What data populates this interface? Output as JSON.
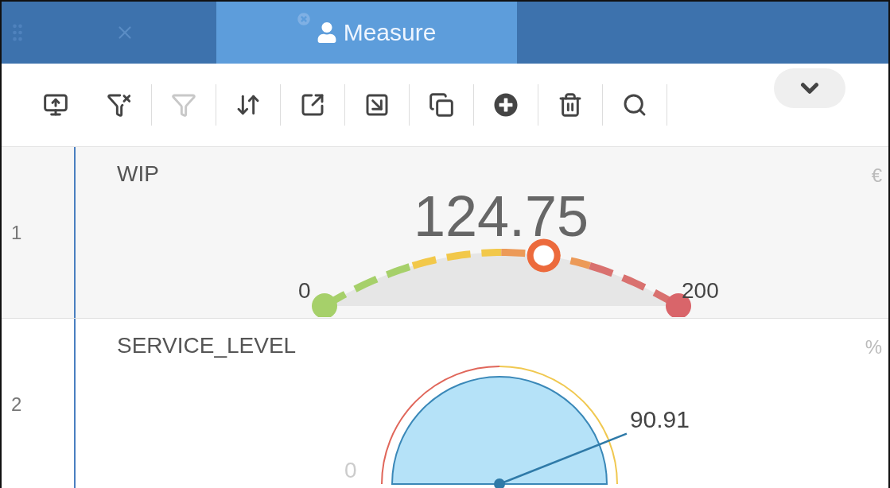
{
  "tabs": [
    {
      "selected": false
    },
    {
      "label": "Measure",
      "selected": true
    }
  ],
  "toolbar": [
    {
      "kind": "upload",
      "disabled": false
    },
    {
      "kind": "filter-clear",
      "disabled": false
    },
    {
      "kind": "filter",
      "disabled": true
    },
    {
      "kind": "sort-clear",
      "disabled": false
    },
    {
      "kind": "export",
      "disabled": false
    },
    {
      "kind": "import",
      "disabled": false
    },
    {
      "kind": "copy",
      "disabled": false
    },
    {
      "kind": "add",
      "disabled": false
    },
    {
      "kind": "delete",
      "disabled": false
    },
    {
      "kind": "search",
      "disabled": false
    },
    {
      "kind": "more",
      "disabled": false
    }
  ],
  "measures": [
    {
      "index": "1",
      "name": "WIP",
      "unit": "€",
      "kind": "arc",
      "value": "124.75",
      "min": "0",
      "max": "200",
      "level": 0.62
    },
    {
      "index": "2",
      "name": "SERVICE_LEVEL",
      "unit": "%",
      "kind": "dial",
      "value": "90.91",
      "min": "0"
    }
  ]
}
